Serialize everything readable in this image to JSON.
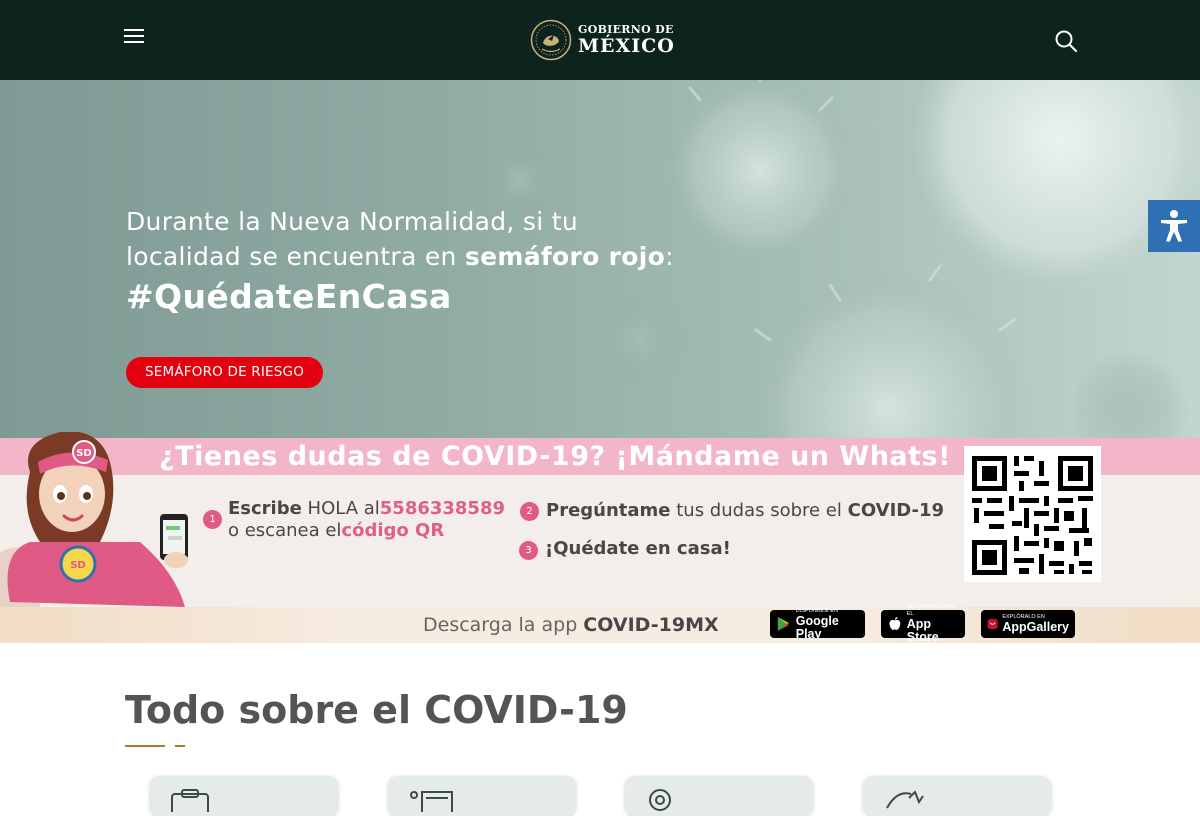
{
  "header": {
    "brand_line1": "GOBIERNO DE",
    "brand_line2": "MÉXICO",
    "menu_icon": "hamburger-menu-icon",
    "search_icon": "search-icon",
    "bg_color": "#0c231e"
  },
  "hero": {
    "line_part1": "Durante la Nueva Normalidad, si tu localidad se encuentra en ",
    "line_bold": "semáforo rojo",
    "line_part2": ":",
    "hashtag": "#QuédateEnCasa",
    "button_label": "SEMÁFORO DE RIESGO",
    "button_color": "#e3000f"
  },
  "accessibility": {
    "icon": "accessibility-icon",
    "color": "#2f6fb3"
  },
  "whatsapp": {
    "title": "¿Tienes dudas de COVID-19? ¡Mándame un Whats!",
    "step1": {
      "num": "1",
      "bold": "Escribe",
      "text": " HOLA al",
      "phone": "5586338589",
      "line2": "o escanea el",
      "link": "código QR"
    },
    "step2": {
      "num": "2",
      "bold": "Pregúntame",
      "text": " tus dudas sobre el ",
      "bold2": "COVID-19"
    },
    "step3": {
      "num": "3",
      "bold": "¡Quédate en casa!"
    },
    "banner_color": "#f3b6c8",
    "accent_color": "#e05a86"
  },
  "app": {
    "text": "Descarga la app ",
    "bold": "COVID-19MX",
    "google_small": "DISPONIBLE EN",
    "google_big": "Google Play",
    "apple_small": "Descárgalo en el",
    "apple_big": "App Store",
    "huawei_small": "EXPLÓRALO EN",
    "huawei_big": "AppGallery"
  },
  "section": {
    "title": "Todo sobre el COVID-19",
    "accent": "#a57f2c"
  }
}
